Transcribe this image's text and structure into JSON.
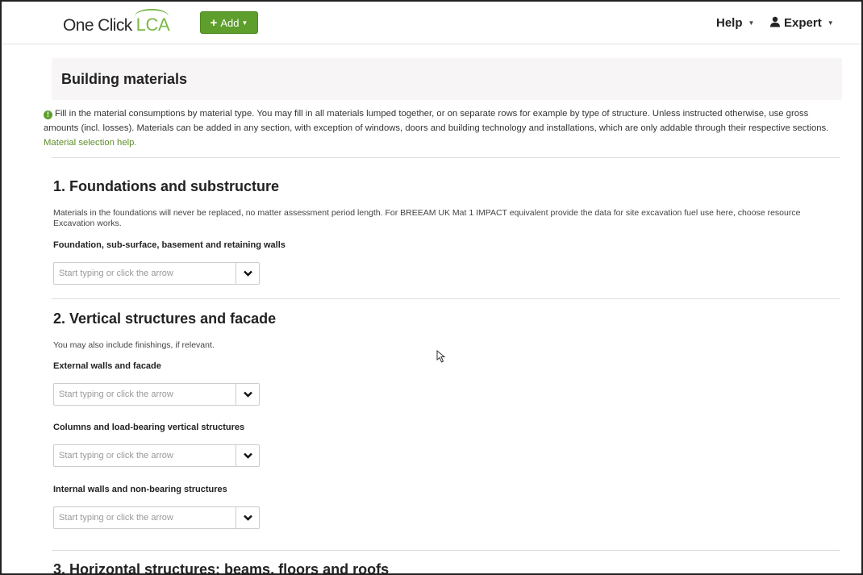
{
  "navbar": {
    "brand_part1": "One Click",
    "brand_part2": "LCA",
    "add_button": "Add",
    "help_menu": "Help",
    "user_menu": "Expert",
    "icons": [
      "plus-icon",
      "caret-down-icon",
      "user-icon"
    ]
  },
  "page": {
    "title": "Building materials",
    "intro_text": "Fill in the material consumptions by material type. You may fill in all materials lumped together, or on separate rows for example by type of structure. Unless instructed otherwise, use gross amounts (incl. losses). Materials can be added in any section, with exception of windows, doors and building technology and installations, which are only addable through their respective sections.",
    "intro_link": "Material selection help."
  },
  "combo_placeholder": "Start typing or click the arrow",
  "sections": [
    {
      "title": "1. Foundations and substructure",
      "description": "Materials in the foundations will never be replaced, no matter assessment period length. For BREEAM UK Mat 1 IMPACT equivalent provide the data for site excavation fuel use here, choose resource Excavation works.",
      "fields": [
        "Foundation, sub-surface, basement and retaining walls"
      ]
    },
    {
      "title": "2. Vertical structures and facade",
      "description": "You may also include finishings, if relevant.",
      "fields": [
        "External walls and facade",
        "Columns and load-bearing vertical structures",
        "Internal walls and non-bearing structures"
      ]
    },
    {
      "title": "3. Horizontal structures: beams, floors and roofs"
    }
  ],
  "colors": {
    "brand_green": "#7bb848",
    "button_green": "#5e9e2c",
    "link_green": "#5e8e2a"
  }
}
